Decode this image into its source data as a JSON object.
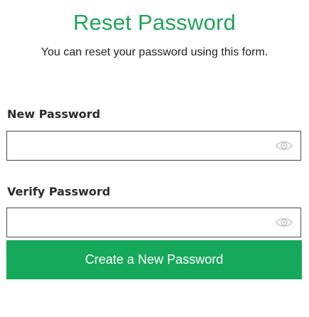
{
  "header": {
    "title": "Reset Password",
    "subtitle": "You can reset your password using this form."
  },
  "form": {
    "new_password": {
      "label": "New Password",
      "value": "",
      "placeholder": "",
      "toggle_icon": "eye-icon"
    },
    "verify_password": {
      "label": "Verify Password",
      "value": "",
      "placeholder": "",
      "toggle_icon": "eye-icon"
    },
    "submit_label": "Create a New Password"
  },
  "colors": {
    "accent": "#1fa55a",
    "button_bg": "#16a85b",
    "button_text": "#ffffff",
    "input_border": "#4a4a4a",
    "icon": "#c8c8c8"
  }
}
